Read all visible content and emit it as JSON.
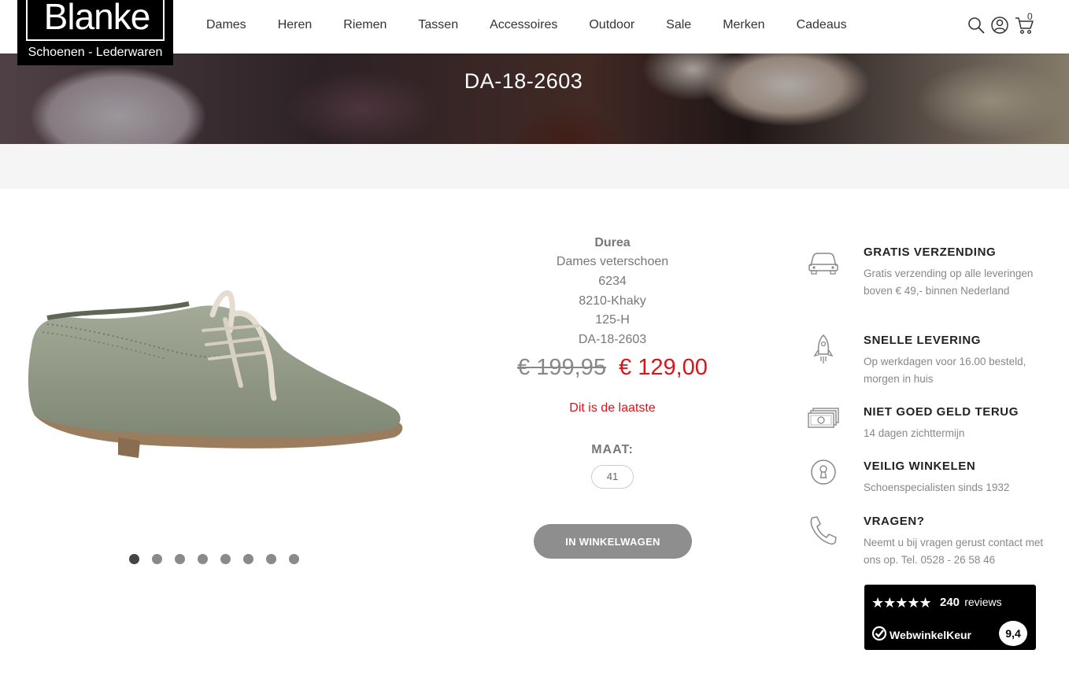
{
  "logo": {
    "name": "Blanke",
    "subtitle": "Schoenen - Lederwaren"
  },
  "nav": [
    "Dames",
    "Heren",
    "Riemen",
    "Tassen",
    "Accessoires",
    "Outdoor",
    "Sale",
    "Merken",
    "Cadeaus"
  ],
  "header_icons": [
    "search-icon",
    "user-icon",
    "cart-icon"
  ],
  "cart": {
    "count": "0"
  },
  "hero": {
    "title": "DA-18-2603"
  },
  "gallery": {
    "dot_count": 8,
    "active_index": 0
  },
  "product": {
    "brand": "Durea",
    "lines": [
      "Dames veterschoen",
      "6234",
      "8210-Khaky",
      "125-H",
      "DA-18-2603"
    ],
    "old_price": "€ 199,95",
    "new_price": "€ 129,00",
    "stock_note": "Dit is de laatste",
    "size_label": "MAAT:",
    "sizes": [
      "41"
    ],
    "cart_button": "IN WINKELWAGEN"
  },
  "usps": [
    {
      "icon": "car-icon",
      "title": "GRATIS VERZENDING",
      "text": "Gratis verzending op alle leveringen boven € 49,- binnen Nederland"
    },
    {
      "icon": "rocket-icon",
      "title": "SNELLE LEVERING",
      "text": "Op werkdagen voor 16.00 besteld, morgen in huis"
    },
    {
      "icon": "money-icon",
      "title": "NIET GOED GELD TERUG",
      "text": "14 dagen zichttermijn"
    },
    {
      "icon": "keyhole-icon",
      "title": "VEILIG WINKELEN",
      "text": "Schoenspecialisten sinds 1932"
    },
    {
      "icon": "phone-icon",
      "title": "VRAGEN?",
      "text": "Neemt u bij vragen gerust contact met ons op. Tel. 0528 - 26 58 46"
    }
  ],
  "reviews": {
    "stars": "★★★★★",
    "count": "240",
    "count_word": "reviews",
    "brand": "WebwinkelKeur",
    "score": "9,4"
  },
  "colors": {
    "accent_red": "#d8151b",
    "button_grey": "#8e8e8e"
  }
}
